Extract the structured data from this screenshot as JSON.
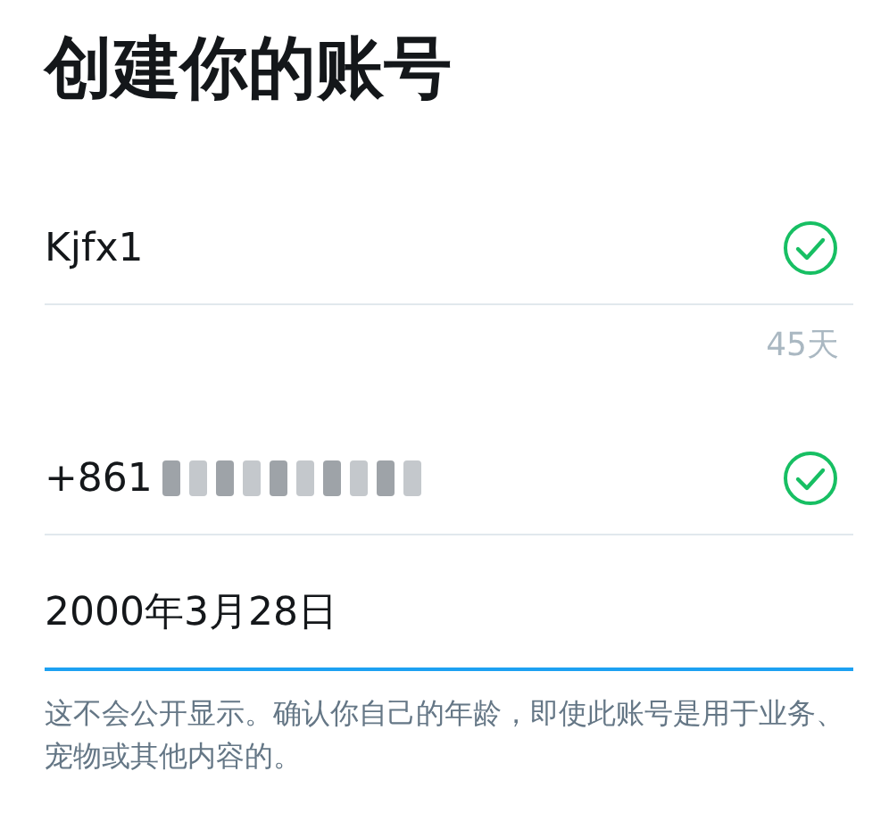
{
  "title": "创建你的账号",
  "fields": [
    {
      "value": "Kjfx1",
      "valid": true,
      "focused": false,
      "counter": "45天"
    },
    {
      "value": "+861",
      "valid": true,
      "focused": false,
      "redacted": true
    },
    {
      "value": "2000年3月28日",
      "valid": false,
      "focused": true
    }
  ],
  "helper_text": "这不会公开显示。确认你自己的年龄，即使此账号是用于业务、宠物或其他内容的。"
}
